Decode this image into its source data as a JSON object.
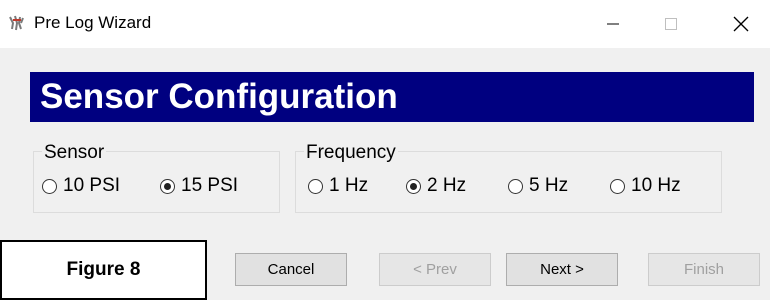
{
  "window": {
    "title": "Pre Log Wizard",
    "icon": "wizard-app-icon",
    "controls": [
      "minimize",
      "maximize",
      "close"
    ]
  },
  "banner": {
    "title": "Sensor Configuration",
    "background": "#000080"
  },
  "sensor_group": {
    "legend": "Sensor",
    "options": [
      {
        "label": "10 PSI",
        "checked": false
      },
      {
        "label": "15 PSI",
        "checked": true
      }
    ]
  },
  "frequency_group": {
    "legend": "Frequency",
    "options": [
      {
        "label": "1 Hz",
        "checked": false
      },
      {
        "label": "2 Hz",
        "checked": true
      },
      {
        "label": "5 Hz",
        "checked": false
      },
      {
        "label": "10 Hz",
        "checked": false
      }
    ]
  },
  "buttons": {
    "cancel": "Cancel",
    "prev": "< Prev",
    "next": "Next >",
    "finish": "Finish"
  },
  "figure_label": "Figure 8"
}
